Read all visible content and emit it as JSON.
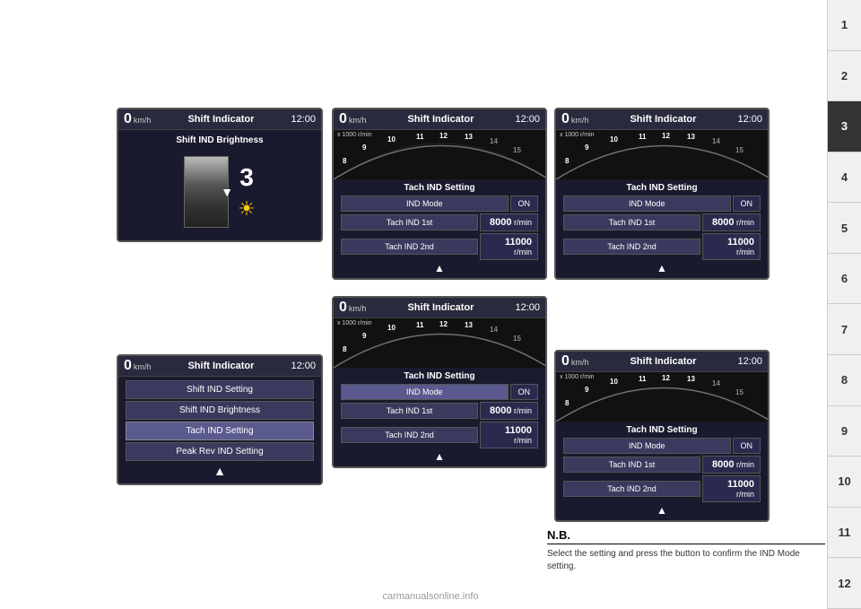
{
  "chapters": [
    "1",
    "2",
    "3",
    "4",
    "5",
    "6",
    "7",
    "8",
    "9",
    "10",
    "11",
    "12"
  ],
  "active_chapter": "3",
  "watermark": "carmanualsonline.info",
  "screen_brightness": {
    "speed": "0",
    "speed_unit": "km/h",
    "title": "Shift Indicator",
    "time": "12:00",
    "section_title": "Shift IND Brightness",
    "brightness_value": "3"
  },
  "screen_menu": {
    "speed": "0",
    "speed_unit": "km/h",
    "title": "Shift Indicator",
    "time": "12:00",
    "items": [
      "Shift IND Setting",
      "Shift IND Brightness",
      "Tach IND Setting",
      "Peak Rev IND Setting"
    ]
  },
  "screen_tach1": {
    "speed": "0",
    "speed_unit": "km/h",
    "title": "Shift Indicator",
    "time": "12:00",
    "x1000": "x 1000 r/min",
    "section_title": "Tach IND Setting",
    "rows": [
      {
        "label": "IND Mode",
        "value": "ON",
        "is_on": true
      },
      {
        "label": "Tach IND 1st",
        "value": "8000",
        "unit": "r/min"
      },
      {
        "label": "Tach IND 2nd",
        "value": "11000",
        "unit": "r/min"
      }
    ],
    "tach_numbers": [
      "8",
      "9",
      "10",
      "11",
      "12",
      "13",
      "14",
      "15"
    ]
  },
  "screen_tach2": {
    "speed": "0",
    "speed_unit": "km/h",
    "title": "Shift Indicator",
    "time": "12:00",
    "x1000": "x 1000 r/min",
    "section_title": "Tach IND Setting",
    "rows": [
      {
        "label": "IND Mode",
        "value": "ON",
        "is_on": true
      },
      {
        "label": "Tach IND 1st",
        "value": "8000",
        "unit": "r/min"
      },
      {
        "label": "Tach IND 2nd",
        "value": "11000",
        "unit": "r/min"
      }
    ],
    "tach_numbers": [
      "8",
      "9",
      "10",
      "11",
      "12",
      "13",
      "14",
      "15"
    ]
  },
  "screen_tach3": {
    "speed": "0",
    "speed_unit": "km/h",
    "title": "Shift Indicator",
    "time": "12:00",
    "x1000": "x 1000 r/min",
    "section_title": "Tach IND Setting",
    "rows": [
      {
        "label": "IND Mode",
        "value": "ON",
        "is_on": true
      },
      {
        "label": "Tach IND 1st",
        "value": "8000",
        "unit": "r/min"
      },
      {
        "label": "Tach IND 2nd",
        "value": "11000",
        "unit": "r/min"
      }
    ],
    "tach_numbers": [
      "8",
      "9",
      "10",
      "11",
      "12",
      "13",
      "14",
      "15"
    ]
  },
  "screen_tach4": {
    "speed": "0",
    "speed_unit": "km/h",
    "title": "Shift Indicator",
    "time": "12:00",
    "x1000": "x 1000 r/min",
    "section_title": "Tach IND Setting",
    "rows": [
      {
        "label": "IND Mode",
        "value": "ON",
        "is_on": true
      },
      {
        "label": "Tach IND 1st",
        "value": "8000",
        "unit": "r/min"
      },
      {
        "label": "Tach IND 2nd",
        "value": "11000",
        "unit": "r/min"
      }
    ],
    "tach_numbers": [
      "8",
      "9",
      "10",
      "11",
      "12",
      "13",
      "14",
      "15"
    ]
  },
  "nb": {
    "title": "N.B.",
    "text": "Select the setting and press the button to confirm the IND Mode setting."
  }
}
